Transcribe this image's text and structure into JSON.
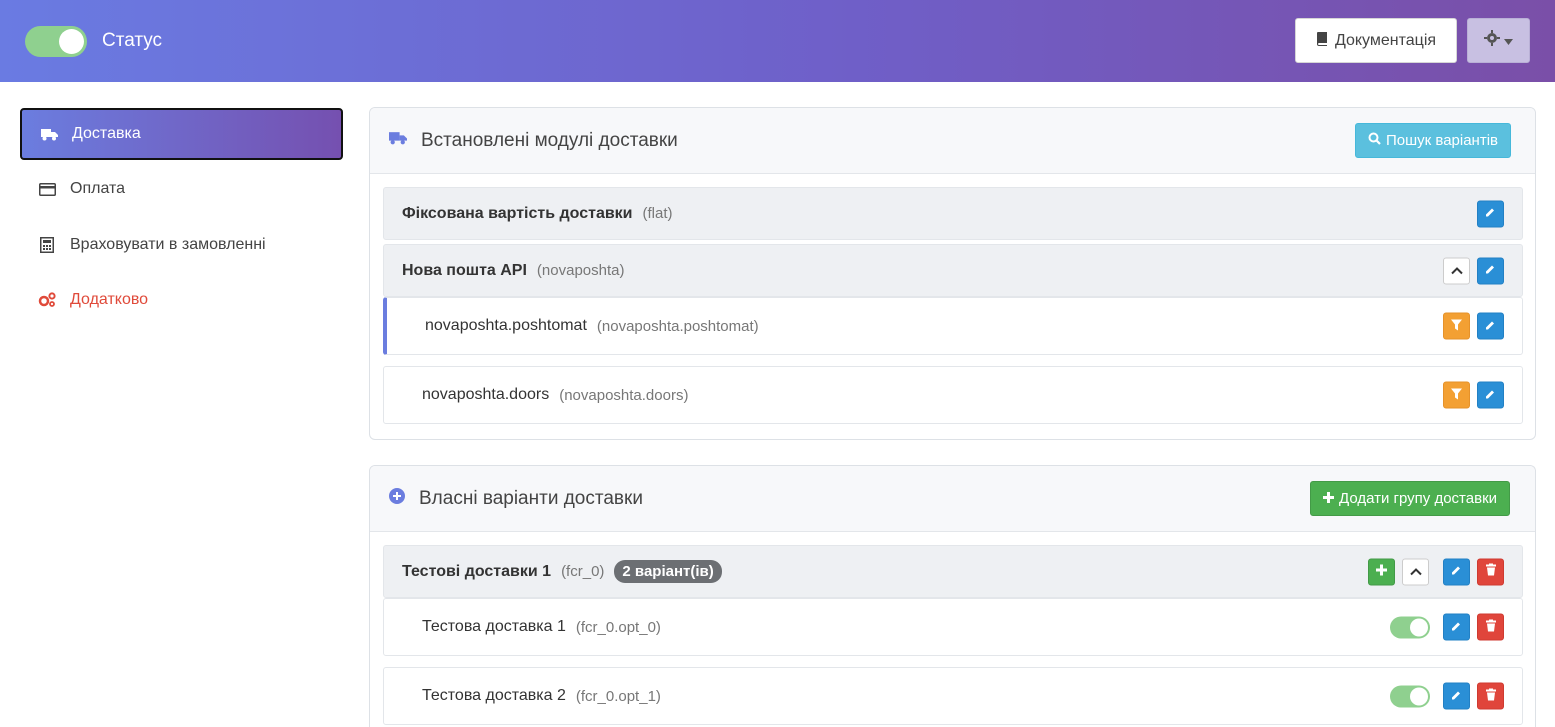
{
  "header": {
    "status_label": "Статус",
    "status_on": true,
    "docs_label": "Документація",
    "doc_icon": "book-icon",
    "settings_icon": "gear-icon"
  },
  "sidebar": {
    "items": [
      {
        "label": "Доставка",
        "icon": "truck-icon",
        "active": true
      },
      {
        "label": "Оплата",
        "icon": "credit-card-icon"
      },
      {
        "label": "Враховувати в замовленні",
        "icon": "calculator-icon"
      },
      {
        "label": "Додатково",
        "icon": "gears-icon",
        "color": "#e04a3a"
      }
    ]
  },
  "installed": {
    "title": "Встановлені модулі доставки",
    "search_label": "Пошук варіантів",
    "rows": [
      {
        "name": "Фіксована вартість доставки",
        "code": "(flat)"
      },
      {
        "name": "Нова пошта API",
        "code": "(novaposhta)"
      },
      {
        "name": "novaposhta.poshtomat",
        "code": "(novaposhta.poshtomat)"
      },
      {
        "name": "novaposhta.doors",
        "code": "(novaposhta.doors)"
      }
    ]
  },
  "custom": {
    "title": "Власні варіанти доставки",
    "add_group_label": "Додати групу доставки",
    "group": {
      "name": "Тестові доставки 1",
      "code": "(fcr_0)",
      "badge": "2 варіант(ів)"
    },
    "options": [
      {
        "name": "Тестова доставка 1",
        "code": "(fcr_0.opt_0)",
        "enabled": true
      },
      {
        "name": "Тестова доставка 2",
        "code": "(fcr_0.opt_1)",
        "enabled": true
      }
    ]
  },
  "colors": {
    "accent": "#6b7ddf",
    "info": "#5bc0de",
    "success": "#4caf50",
    "primary": "#2a8fd6",
    "warning": "#f3a033",
    "danger": "#e0453b"
  }
}
